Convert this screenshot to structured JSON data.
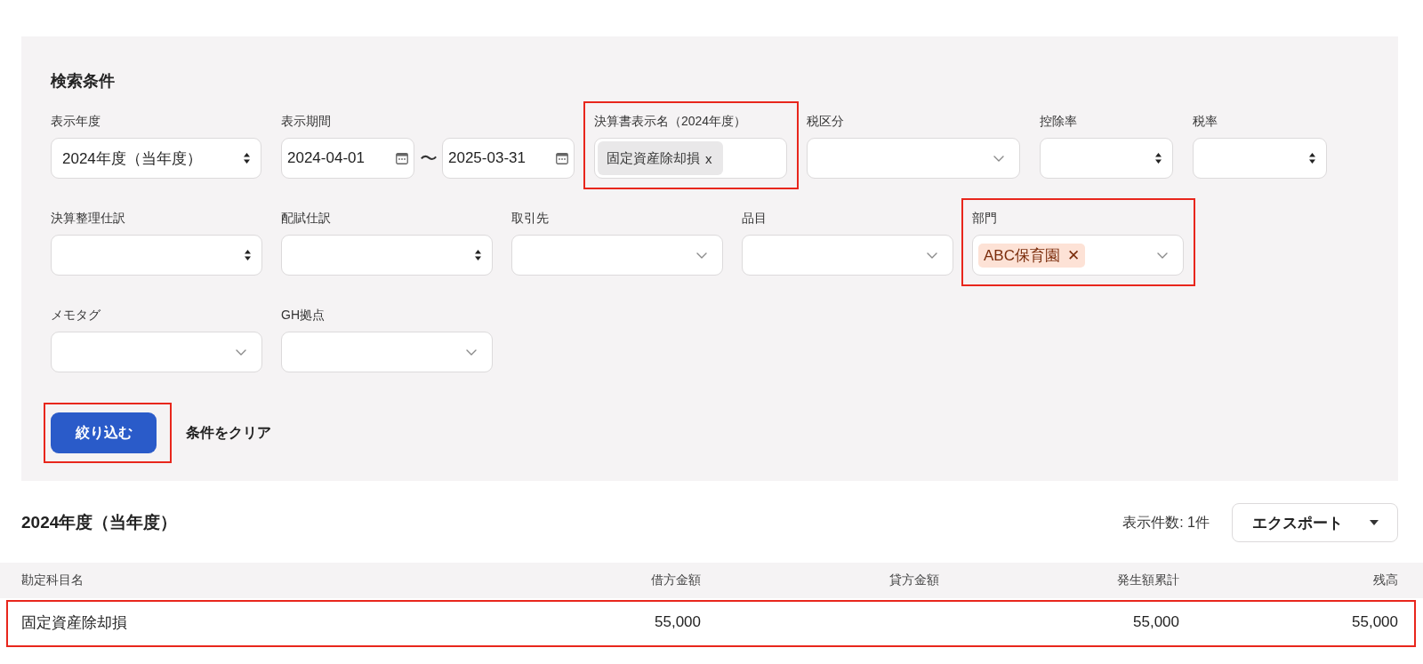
{
  "search": {
    "title": "検索条件",
    "rows": [
      [
        {
          "kind": "select",
          "label": "表示年度",
          "value": "2024年度（当年度）",
          "highlighted": false
        },
        {
          "kind": "date_range",
          "label": "表示期間",
          "from": "2024-04-01",
          "separator": "〜",
          "to": "2025-03-31",
          "highlighted": false
        },
        {
          "kind": "tag_input",
          "label": "決算書表示名（2024年度）",
          "tags": [
            {
              "text": "固定資産除却損",
              "remove": "x"
            }
          ],
          "highlighted": true
        },
        {
          "kind": "dropdown",
          "label": "税区分",
          "highlighted": false
        },
        {
          "kind": "select",
          "label": "控除率",
          "highlighted": false
        },
        {
          "kind": "select",
          "label": "税率",
          "highlighted": false
        }
      ],
      [
        {
          "kind": "select",
          "label": "決算整理仕訳",
          "highlighted": false
        },
        {
          "kind": "select",
          "label": "配賦仕訳",
          "highlighted": false
        },
        {
          "kind": "dropdown",
          "label": "取引先",
          "highlighted": false
        },
        {
          "kind": "dropdown",
          "label": "品目",
          "highlighted": false
        },
        {
          "kind": "multi_select",
          "label": "部門",
          "tags": [
            {
              "text": "ABC保育園",
              "remove": "✕"
            }
          ],
          "highlighted": true
        }
      ],
      [
        {
          "kind": "dropdown",
          "label": "メモタグ",
          "highlighted": false
        },
        {
          "kind": "dropdown",
          "label": "GH拠点",
          "highlighted": false
        }
      ]
    ],
    "apply_button": {
      "label": "絞り込む",
      "highlighted": true
    },
    "clear_button": {
      "label": "条件をクリア"
    }
  },
  "results": {
    "title": "2024年度（当年度）",
    "count": "表示件数: 1件",
    "export_button": {
      "label": "エクスポート"
    },
    "table": {
      "columns": [
        "勘定科目名",
        "借方金額",
        "貸方金額",
        "発生額累計",
        "残高"
      ],
      "rows": [
        {
          "cells": [
            "固定資産除却損",
            "55,000",
            null,
            "55,000",
            "55,000"
          ],
          "highlighted": true
        }
      ]
    }
  }
}
